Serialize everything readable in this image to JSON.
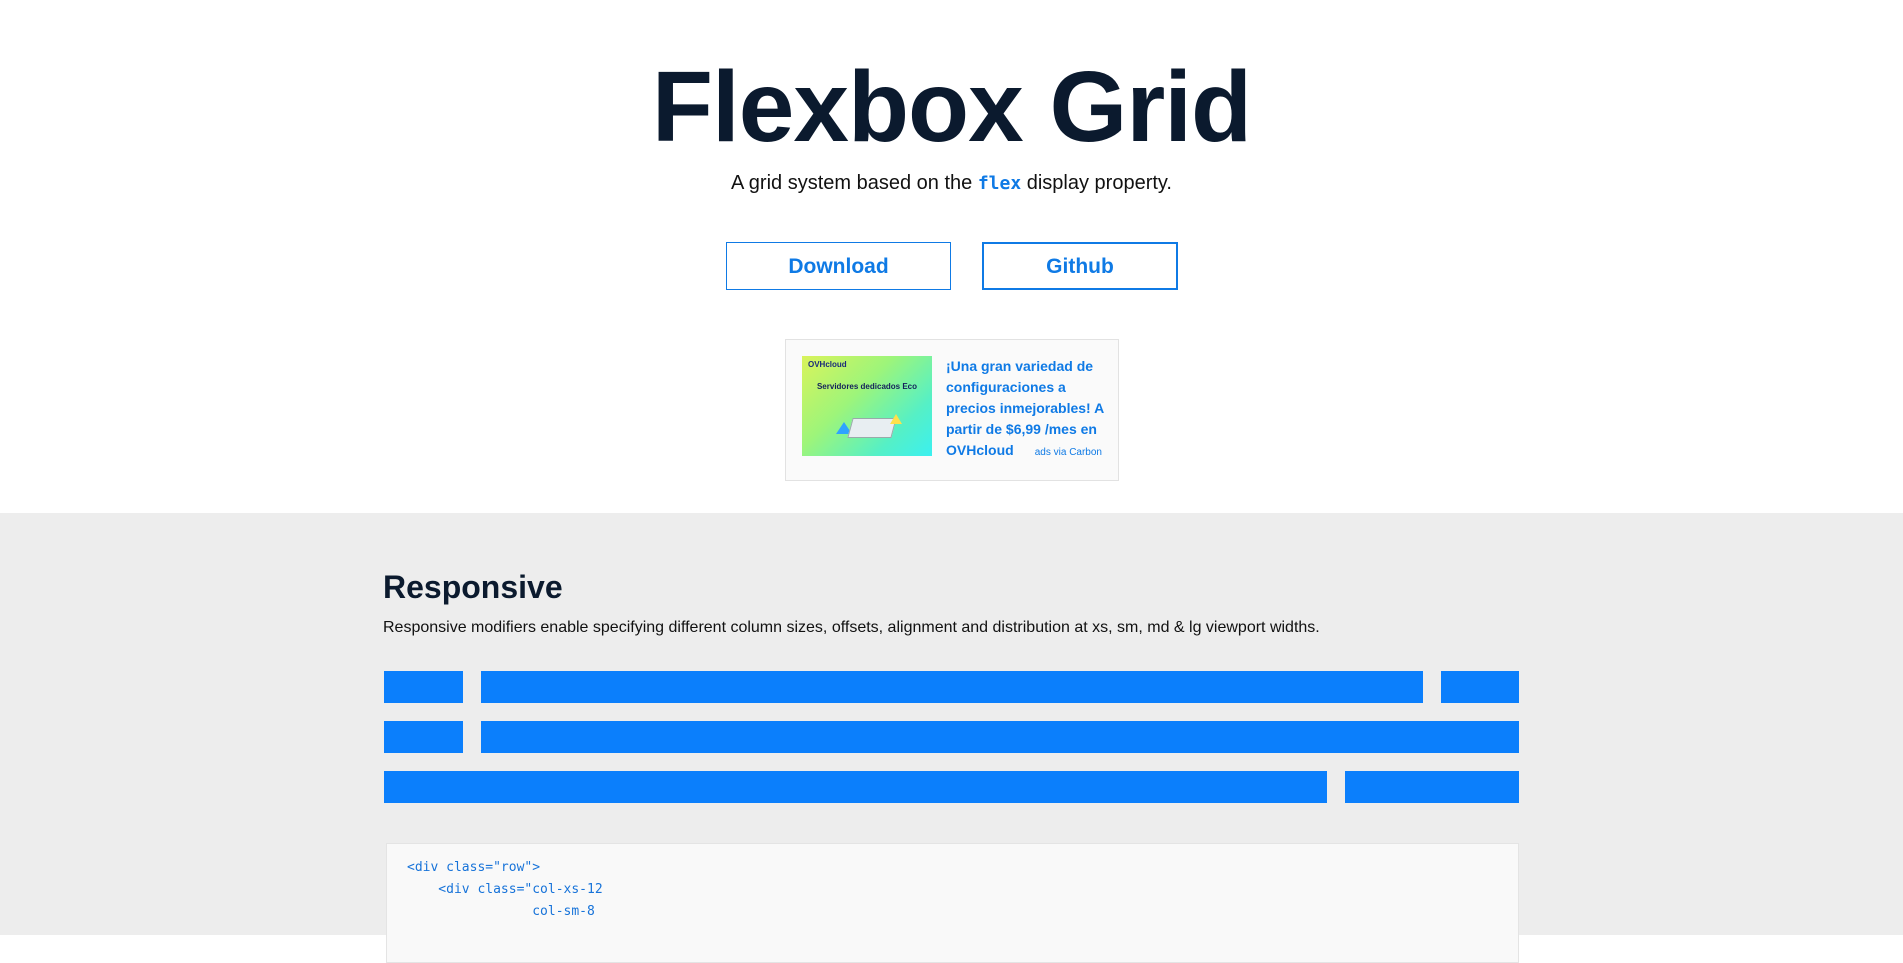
{
  "hero": {
    "title": "Flexbox Grid",
    "subtitle_before": "A grid system based on the ",
    "subtitle_code": "flex",
    "subtitle_after": " display property.",
    "download_label": "Download",
    "github_label": "Github"
  },
  "ad": {
    "logo": "OVHcloud",
    "image_text": "Servidores dedicados Eco",
    "text": "¡Una gran variedad de configuraciones a precios inmejorables! A partir de $6,99 /mes en OVHcloud",
    "via": "ads via Carbon"
  },
  "responsive": {
    "title": "Responsive",
    "description": "Responsive modifiers enable specifying different column sizes, offsets, alignment and distribution at xs, sm, md & lg viewport widths.",
    "accent_color": "#0b7ffc"
  },
  "code": {
    "lines": [
      "<div class=\"row\">",
      "    <div class=\"col-xs-12",
      "                col-sm-8"
    ]
  }
}
